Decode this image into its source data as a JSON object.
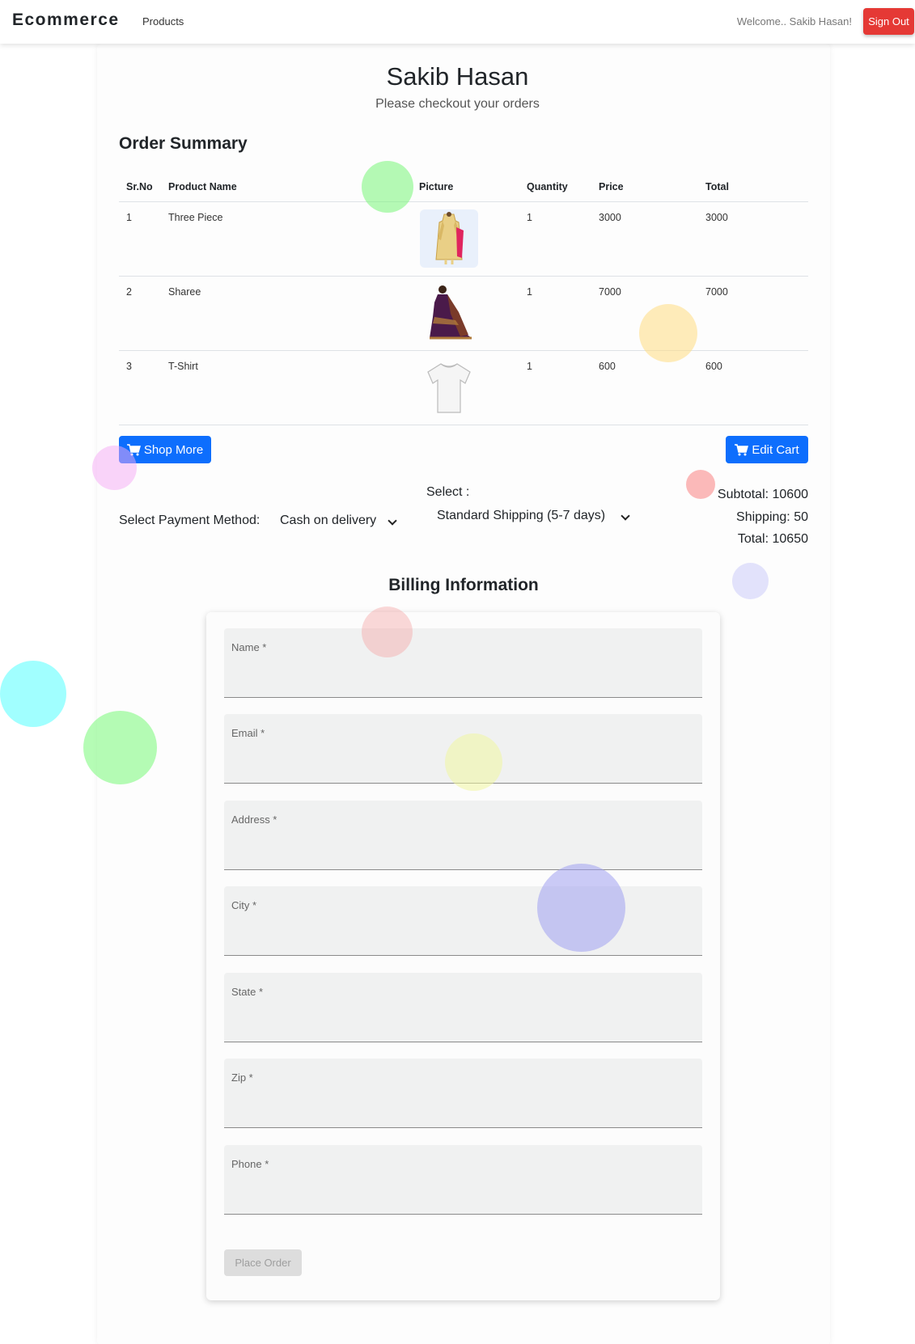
{
  "navbar": {
    "brand": "Ecommerce",
    "products_link": "Products",
    "welcome": "Welcome.. Sakib Hasan!",
    "signout": "Sign Out"
  },
  "header": {
    "name": "Sakib Hasan",
    "subtitle": "Please checkout your orders"
  },
  "order_summary": {
    "title": "Order Summary",
    "columns": [
      "Sr.No",
      "Product Name",
      "Picture",
      "Quantity",
      "Price",
      "Total"
    ],
    "rows": [
      {
        "sr": "1",
        "name": "Three Piece",
        "qty": "1",
        "price": "3000",
        "total": "3000",
        "picture": "three-piece-image"
      },
      {
        "sr": "2",
        "name": "Sharee",
        "qty": "1",
        "price": "7000",
        "total": "7000",
        "picture": "sharee-image"
      },
      {
        "sr": "3",
        "name": "T-Shirt",
        "qty": "1",
        "price": "600",
        "total": "600",
        "picture": "t-shirt-image"
      }
    ]
  },
  "actions": {
    "shop_more": "Shop More",
    "edit_cart": "Edit Cart"
  },
  "payment": {
    "label": "Select Payment Method:",
    "selected": "Cash on delivery"
  },
  "shipping": {
    "label": "Select :",
    "selected": "Standard Shipping (5-7 days)"
  },
  "totals": {
    "subtotal": "Subtotal: 10600",
    "shipping": "Shipping: 50",
    "total": "Total: 10650"
  },
  "billing": {
    "title": "Billing Information",
    "fields": {
      "name": "Name *",
      "email": "Email *",
      "address": "Address *",
      "city": "City *",
      "state": "State *",
      "zip": "Zip *",
      "phone": "Phone *"
    },
    "place_order": "Place Order"
  },
  "colors": {
    "primary": "#0d6efd",
    "danger": "#e53935",
    "field_bg": "#f0f1f1"
  }
}
